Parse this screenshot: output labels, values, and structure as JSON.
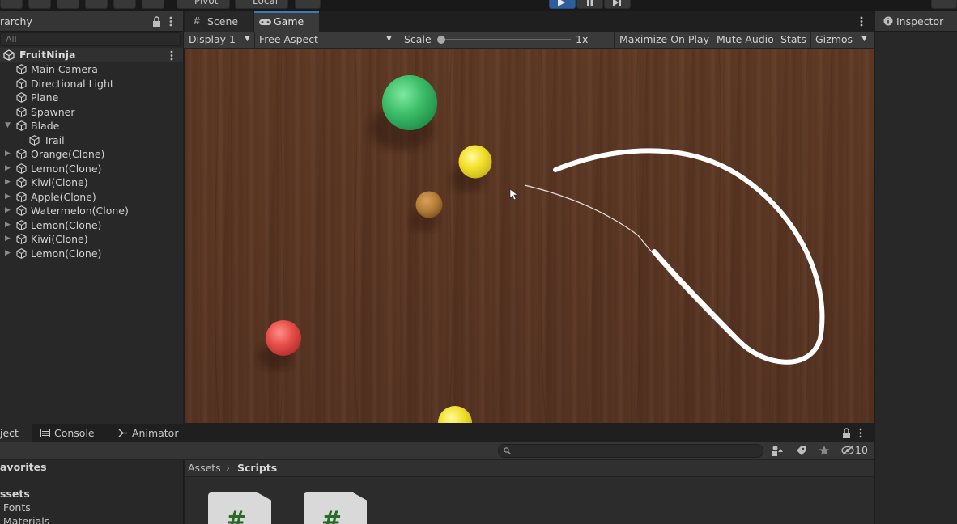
{
  "toolbar": {
    "pivot": "Pivot",
    "local": "Local"
  },
  "hierarchy": {
    "title": "rarchy",
    "search_placeholder": "All",
    "scene": "FruitNinja",
    "items": [
      {
        "label": "Main Camera"
      },
      {
        "label": "Directional Light"
      },
      {
        "label": "Plane"
      },
      {
        "label": "Spawner"
      },
      {
        "label": "Blade"
      },
      {
        "label": "Trail"
      },
      {
        "label": "Orange(Clone)"
      },
      {
        "label": "Lemon(Clone)"
      },
      {
        "label": "Kiwi(Clone)"
      },
      {
        "label": "Apple(Clone)"
      },
      {
        "label": "Watermelon(Clone)"
      },
      {
        "label": "Lemon(Clone)"
      },
      {
        "label": "Kiwi(Clone)"
      },
      {
        "label": "Lemon(Clone)"
      }
    ]
  },
  "game": {
    "tab_scene": "Scene",
    "tab_game": "Game",
    "display": "Display 1",
    "aspect": "Free Aspect",
    "scale_label": "Scale",
    "scale_value": "1x",
    "maximize": "Maximize On Play",
    "mute": "Mute Audio",
    "stats": "Stats",
    "gizmos": "Gizmos"
  },
  "inspector": {
    "title": "Inspector"
  },
  "bottom": {
    "tab_project": "ject",
    "tab_console": "Console",
    "tab_animator": "Animator",
    "hidden_count": "10",
    "favorites": "avorites",
    "assets": "ssets",
    "folders": [
      "Fonts",
      "Materials"
    ],
    "breadcrumb_root": "Assets",
    "breadcrumb_current": "Scripts"
  },
  "colors": {
    "accent_play": "#2f5d9c",
    "wood": "#5a3623",
    "green_fruit": "#3fbf6a",
    "yellow_fruit": "#f2e02a",
    "kiwi_fruit": "#b07a35",
    "red_fruit": "#e8504a"
  }
}
